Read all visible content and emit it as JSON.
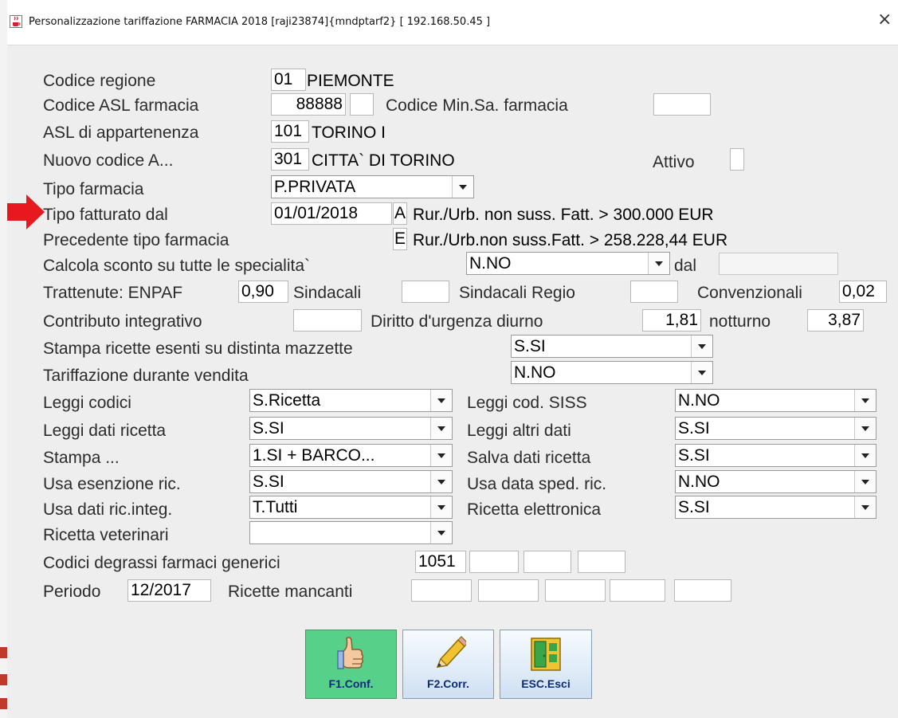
{
  "window": {
    "title": "Personalizzazione tariffazione FARMACIA 2018 [raji23874]{mndptarf2} [ 192.168.50.45 ]",
    "close_glyph": "×"
  },
  "colors": {
    "window_bg": "#eeeeee",
    "confirm_button": "#57d18a",
    "pointer_arrow": "#e8181f",
    "button_label": "#0b2a77"
  },
  "icons": {
    "app": "java-cup-icon",
    "close": "close-icon",
    "pointer": "red-arrow-pointer-icon",
    "confirm": "thumbs-up-icon",
    "correct": "pencil-icon",
    "exit": "exit-door-icon"
  },
  "form": {
    "codice_regione": {
      "label": "Codice regione",
      "code": "01",
      "name": "PIEMONTE"
    },
    "codice_asl": {
      "label": "Codice ASL farmacia",
      "value": "88888",
      "extra": "",
      "minsa_label": "Codice Min.Sa. farmacia",
      "minsa_value": ""
    },
    "asl_appartenenza": {
      "label": "ASL di appartenenza",
      "code": "101",
      "name": "TORINO I"
    },
    "nuovo_codice": {
      "label": "Nuovo codice A...",
      "code": "301",
      "name": "CITTA` DI TORINO",
      "attivo_label": "Attivo",
      "attivo_value": ""
    },
    "tipo_farmacia": {
      "label": "Tipo farmacia",
      "value": "P.PRIVATA"
    },
    "tipo_fatturato": {
      "label": "Tipo fatturato dal",
      "date": "01/01/2018",
      "code": "A",
      "desc": "Rur./Urb. non suss. Fatt. > 300.000 EUR"
    },
    "precedente_tipo": {
      "label": "Precedente tipo farmacia",
      "code": "E",
      "desc": "Rur./Urb.non suss.Fatt. > 258.228,44 EUR"
    },
    "calcola_sconto": {
      "label": "Calcola sconto su tutte le specialita`",
      "value": "N.NO",
      "dal_label": "dal",
      "dal_value": ""
    },
    "trattenute": {
      "label": "Trattenute: ENPAF",
      "enpaf": "0,90",
      "sindacali_label": "Sindacali",
      "sindacali": "",
      "regio_label": "Sindacali Regio",
      "regio": "",
      "conv_label": "Convenzionali",
      "conv": "0,02"
    },
    "contributo": {
      "label": "Contributo integrativo",
      "value": "",
      "diurno_label": "Diritto d'urgenza diurno",
      "diurno": "1,81",
      "notturno_label": "notturno",
      "notturno": "3,87"
    },
    "stampa_esenti": {
      "label": "Stampa ricette esenti su distinta mazzette",
      "value": "S.SI"
    },
    "tariff_vendita": {
      "label": "Tariffazione durante vendita",
      "value": "N.NO"
    },
    "leggi_codici": {
      "label": "Leggi codici",
      "value": "S.Ricetta"
    },
    "leggi_siss": {
      "label": "Leggi cod. SISS",
      "value": "N.NO"
    },
    "leggi_dati": {
      "label": "Leggi dati ricetta",
      "value": "S.SI"
    },
    "leggi_altri": {
      "label": "Leggi altri dati",
      "value": "S.SI"
    },
    "stampa": {
      "label": "Stampa ...",
      "value": "1.SI + BARCO..."
    },
    "salva_dati": {
      "label": "Salva dati ricetta",
      "value": "S.SI"
    },
    "usa_esenzione": {
      "label": "Usa esenzione ric.",
      "value": "S.SI"
    },
    "usa_data_sped": {
      "label": "Usa data sped. ric.",
      "value": "N.NO"
    },
    "usa_dati_integ": {
      "label": "Usa dati ric.integ.",
      "value": "T.Tutti"
    },
    "ricetta_elettr": {
      "label": "Ricetta elettronica",
      "value": "S.SI"
    },
    "ricetta_vet": {
      "label": "Ricetta veterinari",
      "value": ""
    },
    "codici_degrassi": {
      "label": "Codici degrassi farmaci generici",
      "values": [
        "1051",
        "",
        "",
        ""
      ]
    },
    "periodo": {
      "label": "Periodo",
      "value": "12/2017",
      "mancanti_label": "Ricette mancanti",
      "mancanti": [
        "",
        "",
        "",
        "",
        ""
      ]
    }
  },
  "buttons": {
    "confirm": "F1.Conf.",
    "correct": "F2.Corr.",
    "exit": "ESC.Esci"
  }
}
